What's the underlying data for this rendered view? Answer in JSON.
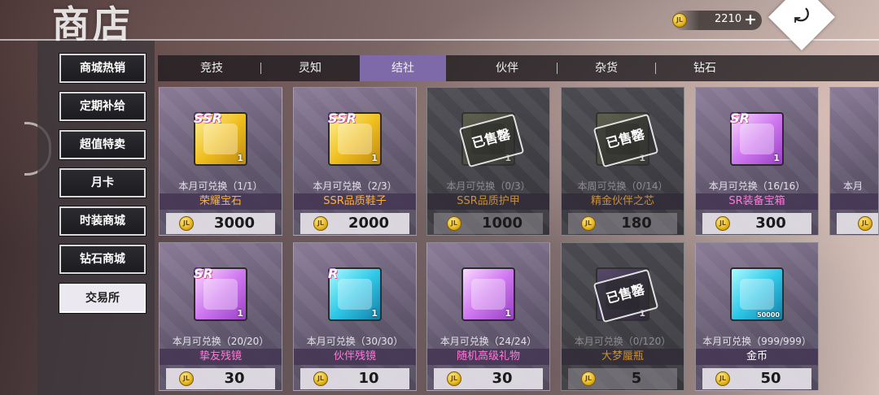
{
  "title": "商店",
  "currency": {
    "amount": "2210",
    "plus": "+"
  },
  "back": {
    "arrow": "⤾"
  },
  "sidebar": {
    "items": [
      {
        "label": "商城热销"
      },
      {
        "label": "定期补给"
      },
      {
        "label": "超值特卖"
      },
      {
        "label": "月卡"
      },
      {
        "label": "时装商城"
      },
      {
        "label": "钻石商城"
      },
      {
        "label": "交易所",
        "active": true
      }
    ]
  },
  "tabs": [
    {
      "label": "竞技"
    },
    {
      "label": "灵知"
    },
    {
      "label": "结社",
      "active": true
    },
    {
      "label": "伙伴"
    },
    {
      "label": "杂货"
    },
    {
      "label": "钻石"
    }
  ],
  "sold_out_label": "已售罄",
  "items": [
    {
      "name": "荣耀宝石",
      "limit": "本月可兑换（1/1）",
      "price": "3000",
      "qty": "1",
      "rarity": "SSR",
      "icon": "gem-icon",
      "name_color": "#ffb13a",
      "sold_out": false
    },
    {
      "name": "SSR品质鞋子",
      "limit": "本月可兑换（2/3）",
      "price": "2000",
      "qty": "1",
      "rarity": "SSR",
      "icon": "shoes-icon",
      "name_color": "#ffb13a",
      "sold_out": false
    },
    {
      "name": "SSR品质护甲",
      "limit": "本月可兑换（0/3）",
      "price": "1000",
      "qty": "1",
      "rarity": "",
      "icon": "armor-icon",
      "name_color": "#ffb13a",
      "sold_out": true
    },
    {
      "name": "精金伙伴之芯",
      "limit": "本周可兑换（0/14）",
      "price": "180",
      "qty": "1",
      "rarity": "",
      "icon": "core-icon",
      "name_color": "#ffb13a",
      "sold_out": true
    },
    {
      "name": "SR装备宝箱",
      "limit": "本月可兑换（16/16）",
      "price": "300",
      "qty": "1",
      "rarity": "SR",
      "icon": "chest-icon",
      "name_color": "#ff7ad8",
      "sold_out": false
    },
    {
      "name": "挚友残镜",
      "limit": "本月可兑换（20/20）",
      "price": "30",
      "qty": "1",
      "rarity": "SR",
      "icon": "mirror-shard-icon",
      "name_color": "#ff7ad8",
      "sold_out": false
    },
    {
      "name": "伙伴残镜",
      "limit": "本月可兑换（30/30）",
      "price": "10",
      "qty": "1",
      "rarity": "R",
      "icon": "mirror-shard-icon",
      "name_color": "#ff7ad8",
      "sold_out": false
    },
    {
      "name": "随机高级礼物",
      "limit": "本月可兑换（24/24）",
      "price": "30",
      "qty": "1",
      "rarity": "",
      "icon": "gift-icon",
      "name_color": "#ff7ad8",
      "sold_out": false
    },
    {
      "name": "大梦蜃瓶",
      "limit": "本月可兑换（0/120）",
      "price": "5",
      "qty": "1",
      "rarity": "",
      "icon": "bottle-icon",
      "name_color": "#ff7ad8",
      "sold_out": true
    },
    {
      "name": "金币",
      "limit": "本月可兑换（999/999）",
      "price": "50",
      "qty": "50000",
      "rarity": "",
      "icon": "gold-coins-icon",
      "name_color": "#ffffff",
      "sold_out": false
    }
  ],
  "partial_card": {
    "limit": "本月"
  }
}
